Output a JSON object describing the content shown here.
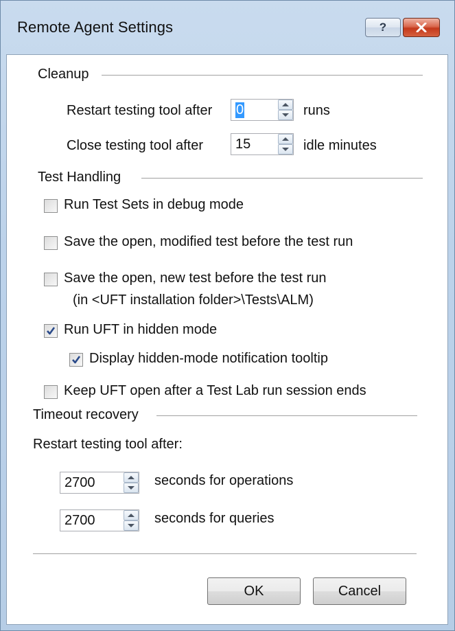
{
  "window": {
    "title": "Remote Agent Settings",
    "help_label": "?",
    "accent_close_color": "#c4391c"
  },
  "cleanup": {
    "heading": "Cleanup",
    "restart_label": "Restart testing tool after",
    "restart_value": "0",
    "restart_unit": "runs",
    "close_label": "Close testing tool after",
    "close_value": "15",
    "close_unit": "idle minutes"
  },
  "test_handling": {
    "heading": "Test Handling",
    "options": [
      {
        "label": "Run Test Sets in debug mode",
        "checked": false
      },
      {
        "label": "Save the open, modified test before the test run",
        "checked": false
      },
      {
        "label": "Save the open, new test before the test run",
        "sublabel": "(in <UFT installation folder>\\Tests\\ALM)",
        "checked": false
      },
      {
        "label": "Run UFT in hidden mode",
        "checked": true
      },
      {
        "label": "Display hidden-mode notification tooltip",
        "checked": true
      },
      {
        "label": "Keep UFT open after a Test Lab run session ends",
        "checked": false
      }
    ]
  },
  "timeout": {
    "heading": "Timeout recovery",
    "restart_label": "Restart testing tool after:",
    "operations_value": "2700",
    "operations_label": "seconds for operations",
    "queries_value": "2700",
    "queries_label": "seconds for queries"
  },
  "buttons": {
    "ok": "OK",
    "cancel": "Cancel"
  }
}
